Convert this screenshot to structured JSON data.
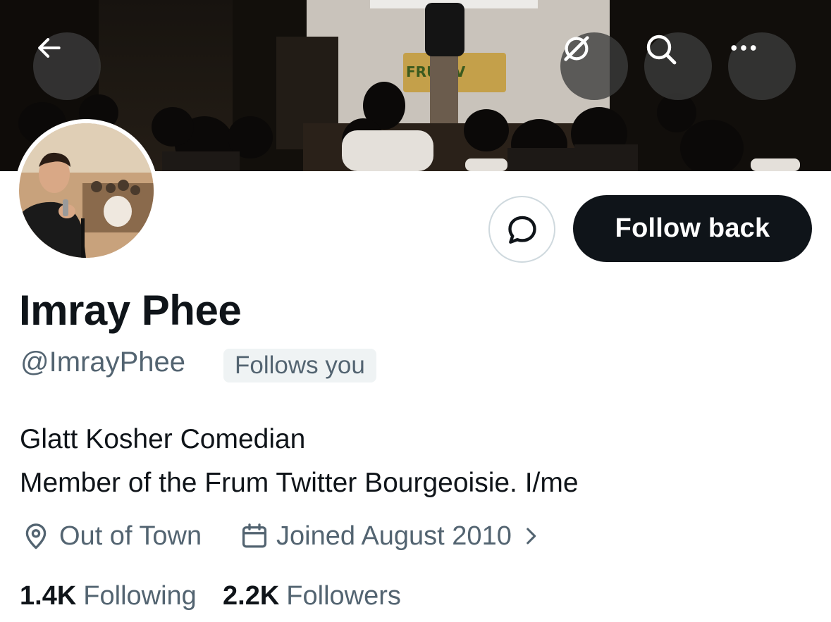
{
  "profile": {
    "display_name": "Imray Phee",
    "handle": "@ImrayPhee",
    "follows_you_badge": "Follows you",
    "bio_lines": [
      "Glatt Kosher Comedian",
      "Member of the Frum Twitter Bourgeoisie. I/me"
    ],
    "location": "Out of Town",
    "joined": "Joined August 2010",
    "following_count": "1.4K",
    "following_label": "Following",
    "followers_count": "2.2K",
    "followers_label": "Followers"
  },
  "actions": {
    "follow_back_label": "Follow back"
  },
  "banner": {
    "sign_text": "FRU    OV"
  },
  "icons": {
    "back": "arrow-left-icon",
    "grok": "grok-icon",
    "search": "search-icon",
    "more": "more-horizontal-icon",
    "message": "message-bubble-icon",
    "location": "location-pin-icon",
    "calendar": "calendar-icon",
    "chevron": "chevron-right-icon"
  },
  "colors": {
    "primary_text": "#0f1419",
    "secondary_text": "#536471",
    "button_bg": "#0f1419",
    "badge_bg": "#eff3f4",
    "border": "#cfd9de"
  }
}
